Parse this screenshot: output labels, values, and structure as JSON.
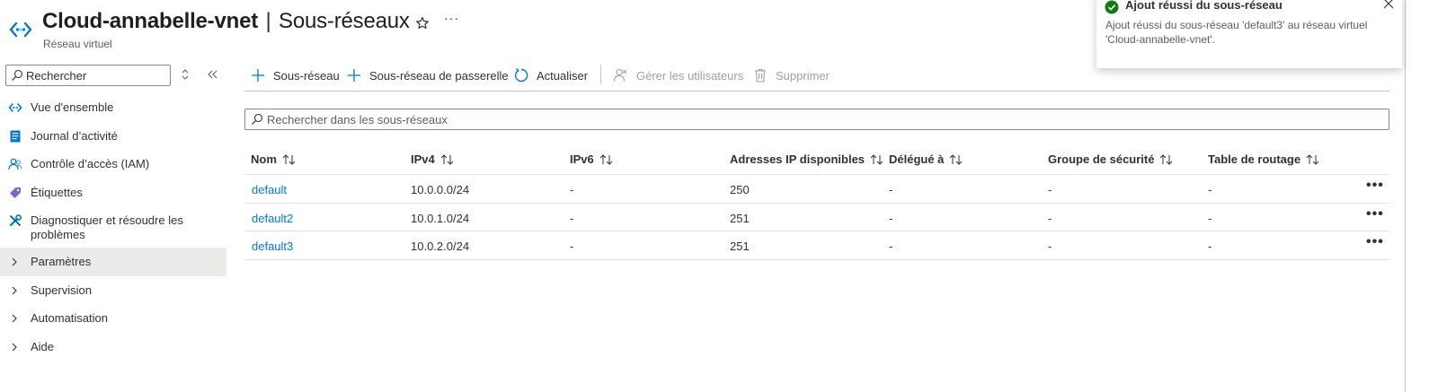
{
  "header": {
    "resource_name": "Cloud-annabelle-vnet",
    "separator": "|",
    "page_name": "Sous-réseaux",
    "subtitle": "Réseau virtuel"
  },
  "sidebar": {
    "search_placeholder": "Rechercher",
    "items": [
      {
        "label": "Vue d'ensemble",
        "icon": "vnet-icon"
      },
      {
        "label": "Journal d’activité",
        "icon": "activity-log-icon"
      },
      {
        "label": "Contrôle d’accès (IAM)",
        "icon": "iam-icon"
      },
      {
        "label": "Étiquettes",
        "icon": "tag-icon"
      },
      {
        "label": "Diagnostiquer et résoudre les problèmes",
        "icon": "wrench-icon"
      },
      {
        "label": "Paramètres",
        "icon": "chevron-right-icon",
        "selected": true
      },
      {
        "label": "Supervision",
        "icon": "chevron-right-icon"
      },
      {
        "label": "Automatisation",
        "icon": "chevron-right-icon"
      },
      {
        "label": "Aide",
        "icon": "chevron-right-icon"
      }
    ]
  },
  "toolbar": {
    "add_subnet": "Sous-réseau",
    "add_gateway_subnet": "Sous-réseau de passerelle",
    "refresh": "Actualiser",
    "manage_users": "Gérer les utilisateurs",
    "delete": "Supprimer"
  },
  "filter": {
    "placeholder": "Rechercher dans les sous-réseaux"
  },
  "table": {
    "columns": [
      "Nom",
      "IPv4",
      "IPv6",
      "Adresses IP disponibles",
      "Délégué à",
      "Groupe de sécurité",
      "Table de routage"
    ],
    "rows": [
      {
        "name": "default",
        "ipv4": "10.0.0.0/24",
        "ipv6": "-",
        "available_ips": "250",
        "delegated": "-",
        "nsg": "-",
        "route_table": "-"
      },
      {
        "name": "default2",
        "ipv4": "10.0.1.0/24",
        "ipv6": "-",
        "available_ips": "251",
        "delegated": "-",
        "nsg": "-",
        "route_table": "-"
      },
      {
        "name": "default3",
        "ipv4": "10.0.2.0/24",
        "ipv6": "-",
        "available_ips": "251",
        "delegated": "-",
        "nsg": "-",
        "route_table": "-"
      }
    ],
    "row_menu_glyph": "•••"
  },
  "notification": {
    "title": "Ajout réussi du sous-réseau",
    "body": "Ajout réussi du sous-réseau 'default3' au réseau virtuel 'Cloud-annabelle-vnet'."
  },
  "colors": {
    "accent": "#0078d4",
    "success": "#107c10",
    "selected_bg": "#edebe9",
    "tag_purple": "#8661c5"
  }
}
